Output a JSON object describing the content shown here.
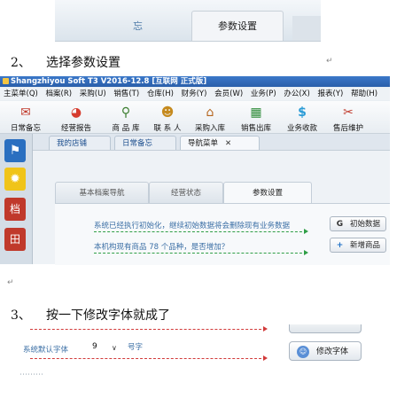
{
  "top_tabs": {
    "left_partial": "忘",
    "active": "参数设置"
  },
  "steps": [
    {
      "num": "2、",
      "text": "选择参数设置"
    },
    {
      "num": "3、",
      "text": "按一下修改字体就成了"
    }
  ],
  "app": {
    "title": "Shangzhiyou Soft T3 V2016-12.8 [互联网 正式版]",
    "menu": [
      "主菜单(Q)",
      "档案(R)",
      "采购(U)",
      "销售(T)",
      "仓库(H)",
      "财务(Y)",
      "会员(W)",
      "业务(P)",
      "办公(X)",
      "报表(Y)",
      "帮助(H)"
    ],
    "toolbar": [
      "日常备忘",
      "经营报告",
      "商 品 库",
      "联 系 人",
      "采购入库",
      "销售出库",
      "业务收款",
      "售后维护"
    ],
    "side_glyph_1": "档",
    "side_glyph_2": "田",
    "nav_tabs": [
      "我的店铺",
      "日常备忘",
      "导航菜单"
    ],
    "nav_close": "✕",
    "sub_tabs": [
      "基本档案导航",
      "经营状态",
      "参数设置"
    ],
    "info_lines": [
      "系统已经执行初始化，继续初始数据将会删除现有业务数据",
      "本机构现有商品 78 个品种，是否增加？"
    ],
    "buttons": [
      "初始数据",
      "新增商品"
    ],
    "button_icons": [
      "G",
      "+"
    ]
  },
  "font_setting": {
    "label": "系统默认字体",
    "value": "9",
    "chevron": "∨",
    "unit": "号字",
    "button": "修改字体"
  },
  "colors": {
    "title_blue": "#2f67b5",
    "link_blue": "#3b6fa5",
    "arrow_green": "#2f9e46",
    "arrow_red": "#d23a3a"
  }
}
